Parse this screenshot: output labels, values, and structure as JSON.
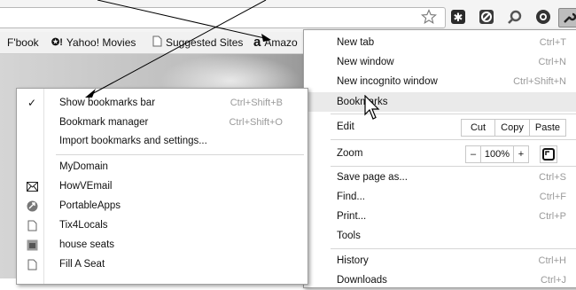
{
  "bookmarks_bar": [
    {
      "label": "F'book",
      "icon": "none"
    },
    {
      "label": "Yahoo! Movies",
      "icon": "yahoo-icon"
    },
    {
      "label": "Suggested Sites",
      "icon": "page-icon"
    },
    {
      "label": "Amazo",
      "icon": "amazon-icon"
    }
  ],
  "main_menu": {
    "new_tab": {
      "label": "New tab",
      "shortcut": "Ctrl+T"
    },
    "new_window": {
      "label": "New window",
      "shortcut": "Ctrl+N"
    },
    "new_incognito": {
      "label": "New incognito window",
      "shortcut": "Ctrl+Shift+N"
    },
    "bookmarks": {
      "label": "Bookmarks"
    },
    "edit": {
      "label": "Edit",
      "cut": "Cut",
      "copy": "Copy",
      "paste": "Paste"
    },
    "zoom": {
      "label": "Zoom",
      "minus": "–",
      "value": "100%",
      "plus": "+"
    },
    "save_page": {
      "label": "Save page as...",
      "shortcut": "Ctrl+S"
    },
    "find": {
      "label": "Find...",
      "shortcut": "Ctrl+F"
    },
    "print": {
      "label": "Print...",
      "shortcut": "Ctrl+P"
    },
    "tools": {
      "label": "Tools"
    },
    "history": {
      "label": "History",
      "shortcut": "Ctrl+H"
    },
    "downloads": {
      "label": "Downloads",
      "shortcut": "Ctrl+J"
    }
  },
  "bookmarks_submenu": {
    "show_bar": {
      "label": "Show bookmarks bar",
      "shortcut": "Ctrl+Shift+B",
      "checked": true
    },
    "manager": {
      "label": "Bookmark manager",
      "shortcut": "Ctrl+Shift+O"
    },
    "import": {
      "label": "Import bookmarks and settings..."
    },
    "items": [
      {
        "label": "MyDomain",
        "icon": "none"
      },
      {
        "label": "HowVEmail",
        "icon": "envelope-icon"
      },
      {
        "label": "PortableApps",
        "icon": "portableapps-icon"
      },
      {
        "label": "Tix4Locals",
        "icon": "page-icon"
      },
      {
        "label": "house seats",
        "icon": "house-seats-icon"
      },
      {
        "label": "Fill A Seat",
        "icon": "page-icon"
      }
    ]
  },
  "colors": {
    "toolbar": "#f4f4f4",
    "menu_highlight": "#eaeaea",
    "shortcut_text": "#9a9a9a"
  }
}
